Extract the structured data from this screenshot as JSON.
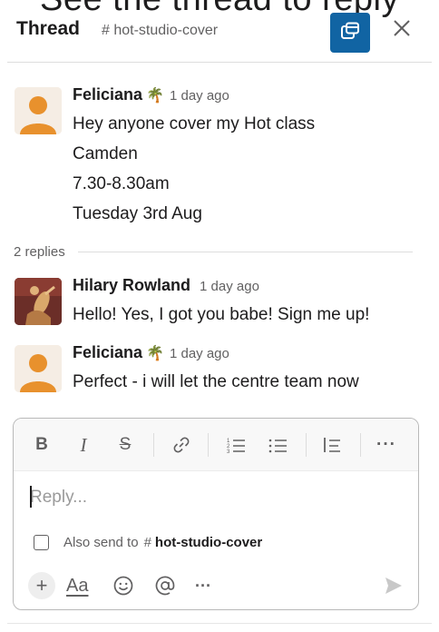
{
  "caption": "See the thread to reply",
  "header": {
    "title": "Thread",
    "channel": "# hot-studio-cover",
    "popout_icon": "popout-window-icon",
    "close_icon": "close-icon"
  },
  "parent_message": {
    "author": "Feliciana",
    "emoji": "🌴",
    "time": "1 day ago",
    "lines": [
      "Hey anyone cover my Hot class",
      "Camden",
      "7.30-8.30am",
      "Tuesday 3rd Aug"
    ]
  },
  "replies_count_label": "2 replies",
  "replies": [
    {
      "author": "Hilary Rowland",
      "time": "1 day ago",
      "text": "Hello! Yes, I got you babe! Sign me up!"
    },
    {
      "author": "Feliciana",
      "emoji": "🌴",
      "time": "1 day ago",
      "text": "Perfect - i will let the centre team now"
    }
  ],
  "composer": {
    "toolbar": {
      "bold": "B",
      "italic": "I",
      "strike": "S",
      "more": "···"
    },
    "placeholder": "Reply...",
    "also_send_label": "Also send to",
    "also_send_hash": "#",
    "also_send_channel": "hot-studio-cover",
    "also_send_checked": false,
    "bottom": {
      "plus": "+",
      "format": "Aa",
      "more": "···"
    }
  },
  "colors": {
    "accent": "#1164a3",
    "text": "#1d1c1d",
    "muted": "#616061",
    "avatar_default": "#e8912d"
  }
}
